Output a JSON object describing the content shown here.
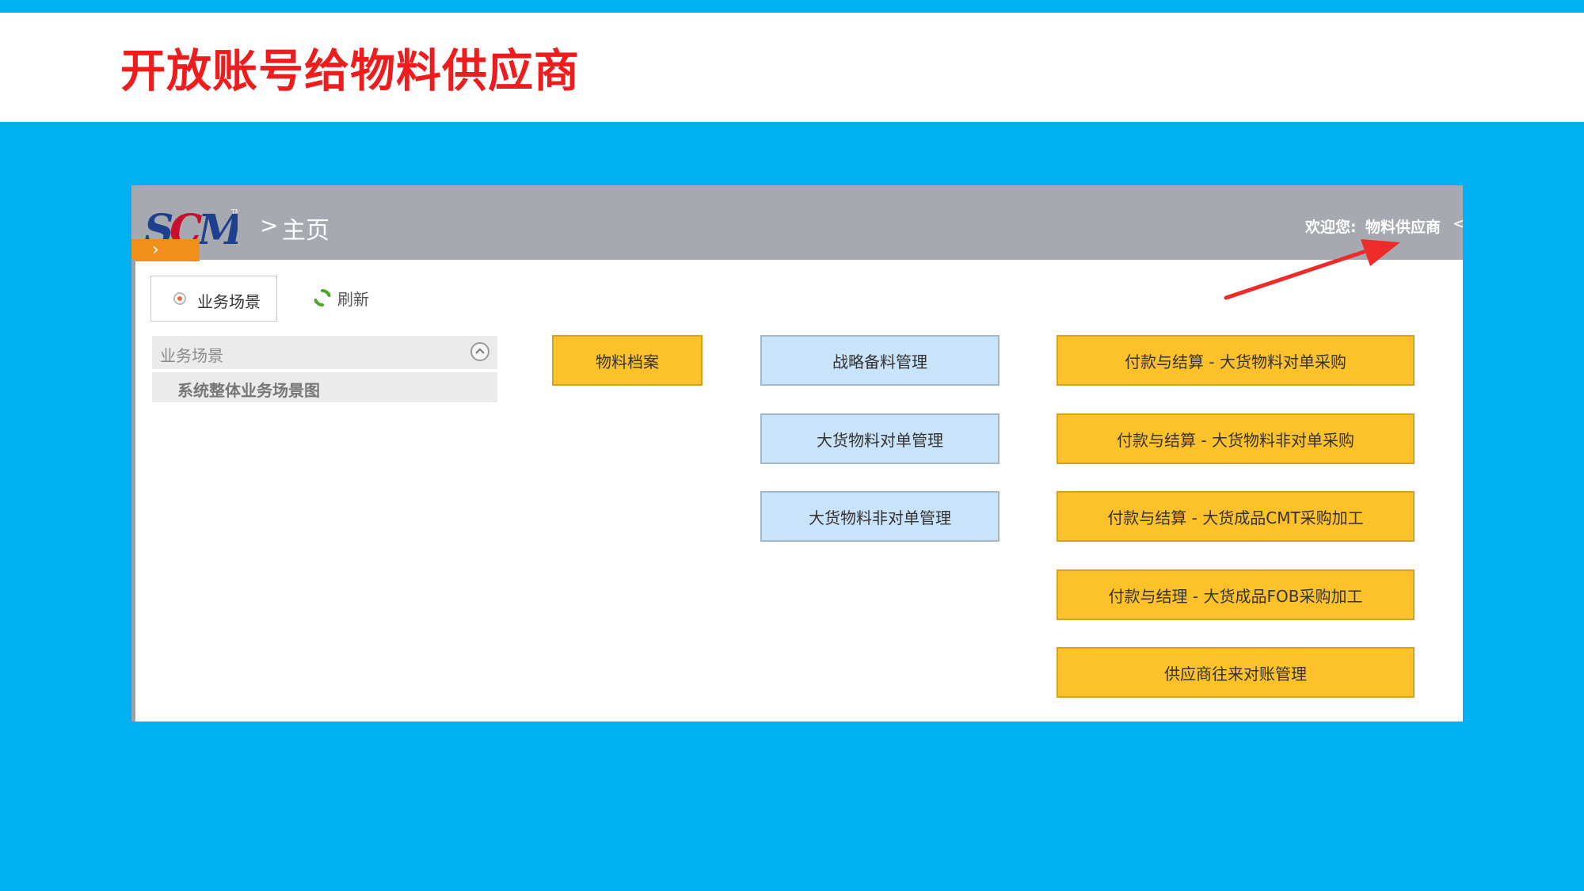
{
  "slide": {
    "title": "开放账号给物料供应商"
  },
  "header": {
    "breadcrumb_sep": ">",
    "home": "主页",
    "welcome_label": "欢迎您:",
    "user_name": "物料供应商",
    "caret": "<",
    "toggle_glyph": "›"
  },
  "toolbar": {
    "tab_label": "业务场景",
    "refresh_label": "刷新"
  },
  "tree": {
    "header": "业务场景",
    "items": [
      "系统整体业务场景图"
    ]
  },
  "tiles": {
    "col1": [
      "物料档案"
    ],
    "col2": [
      "战略备料管理",
      "大货物料对单管理",
      "大货物料非对单管理"
    ],
    "col3": [
      "付款与结算 - 大货物料对单采购",
      "付款与结算 - 大货物料非对单采购",
      "付款与结算 - 大货成品CMT采购加工",
      "付款与结理 - 大货成品FOB采购加工",
      "供应商往来对账管理"
    ]
  },
  "colors": {
    "accent_blue": "#00b0f0",
    "title_red": "#ee1c1c",
    "tile_yellow": "#fdc12a",
    "tile_blue": "#c9e3fa",
    "header_gray": "#a7a9b1",
    "toggle_orange": "#f28f1a",
    "arrow_red": "#ee2b2b"
  },
  "icons": {
    "logo": "scm-logo",
    "refresh": "refresh-icon",
    "collapse": "chevron-up-circle-icon",
    "radio": "radio-selected-icon",
    "annotation": "red-arrow-icon"
  }
}
